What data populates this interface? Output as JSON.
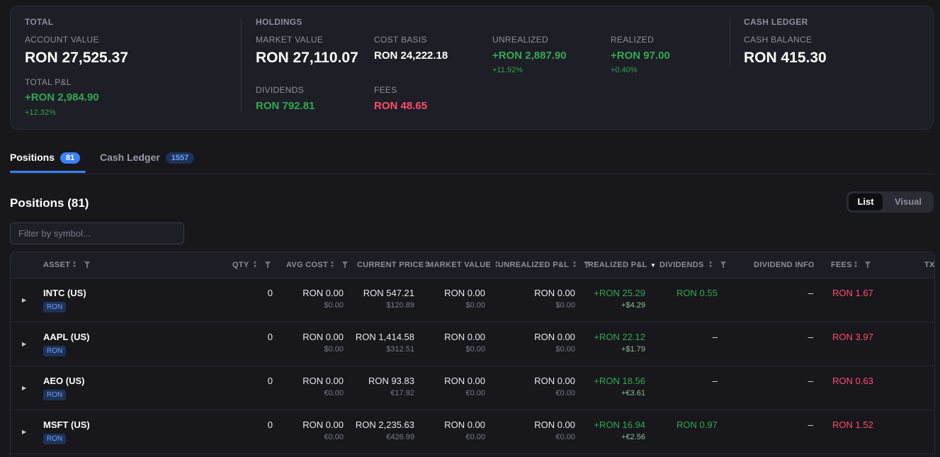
{
  "summary": {
    "total": {
      "title": "TOTAL",
      "account_value_label": "ACCOUNT VALUE",
      "account_value": "RON 27,525.37",
      "pnl_label": "TOTAL P&L",
      "pnl_value": "+RON 2,984.90",
      "pnl_pct": "+12.32%"
    },
    "holdings": {
      "title": "HOLDINGS",
      "market_value_label": "MARKET VALUE",
      "market_value": "RON 27,110.07",
      "cost_basis_label": "COST BASIS",
      "cost_basis": "RON 24,222.18",
      "unrealized_label": "UNREALIZED",
      "unrealized": "+RON 2,887.90",
      "unrealized_pct": "+11.92%",
      "realized_label": "REALIZED",
      "realized": "+RON 97.00",
      "realized_pct": "+0.40%",
      "dividends_label": "DIVIDENDS",
      "dividends": "RON 792.81",
      "fees_label": "FEES",
      "fees": "RON 48.65"
    },
    "cash": {
      "title": "CASH LEDGER",
      "balance_label": "CASH BALANCE",
      "balance": "RON 415.30"
    }
  },
  "tabs": [
    {
      "label": "Positions",
      "count": "81"
    },
    {
      "label": "Cash Ledger",
      "count": "1557"
    }
  ],
  "positions": {
    "heading": "Positions (81)",
    "view_toggle": {
      "list": "List",
      "visual": "Visual"
    },
    "filter_placeholder": "Filter by symbol..."
  },
  "table": {
    "columns": {
      "asset": "ASSET",
      "qty": "QTY",
      "avg_cost": "AVG COST",
      "current_price": "CURRENT PRICE",
      "market_value": "MARKET VALUE",
      "unrealized": "UNREALIZED P&L",
      "realized": "REALIZED P&L",
      "dividends": "DIVIDENDS",
      "dividend_info": "DIVIDEND INFO",
      "fees": "FEES",
      "tx": "TX"
    },
    "rows": [
      {
        "symbol": "INTC (US)",
        "currency": "RON",
        "qty": "0",
        "avg_cost": "RON 0.00",
        "avg_cost_sub": "$0.00",
        "price": "RON 547.21",
        "price_sub": "$120.89",
        "mv": "RON 0.00",
        "mv_sub": "$0.00",
        "unreal": "RON 0.00",
        "unreal_sub": "$0.00",
        "real": "+RON 25.29",
        "real_sub": "+$4.29",
        "div": "RON 0.55",
        "div_info": "–",
        "fees": "RON 1.67"
      },
      {
        "symbol": "AAPL (US)",
        "currency": "RON",
        "qty": "0",
        "avg_cost": "RON 0.00",
        "avg_cost_sub": "$0.00",
        "price": "RON 1,414.58",
        "price_sub": "$312.51",
        "mv": "RON 0.00",
        "mv_sub": "$0.00",
        "unreal": "RON 0.00",
        "unreal_sub": "$0.00",
        "real": "+RON 22.12",
        "real_sub": "+$1.79",
        "div": "–",
        "div_info": "–",
        "fees": "RON 3.97"
      },
      {
        "symbol": "AEO (US)",
        "currency": "RON",
        "qty": "0",
        "avg_cost": "RON 0.00",
        "avg_cost_sub": "€0.00",
        "price": "RON 93.83",
        "price_sub": "€17.92",
        "mv": "RON 0.00",
        "mv_sub": "€0.00",
        "unreal": "RON 0.00",
        "unreal_sub": "€0.00",
        "real": "+RON 18.56",
        "real_sub": "+€3.61",
        "div": "–",
        "div_info": "–",
        "fees": "RON 0.63"
      },
      {
        "symbol": "MSFT (US)",
        "currency": "RON",
        "qty": "0",
        "avg_cost": "RON 0.00",
        "avg_cost_sub": "€0.00",
        "price": "RON 2,235.63",
        "price_sub": "€426.99",
        "mv": "RON 0.00",
        "mv_sub": "€0.00",
        "unreal": "RON 0.00",
        "unreal_sub": "€0.00",
        "real": "+RON 16.94",
        "real_sub": "+€2.56",
        "div": "RON 0.97",
        "div_info": "–",
        "fees": "RON 1.52"
      }
    ]
  },
  "colors": {
    "positive": "#34a853",
    "negative": "#ff4d6d",
    "accent": "#3b82f6"
  }
}
